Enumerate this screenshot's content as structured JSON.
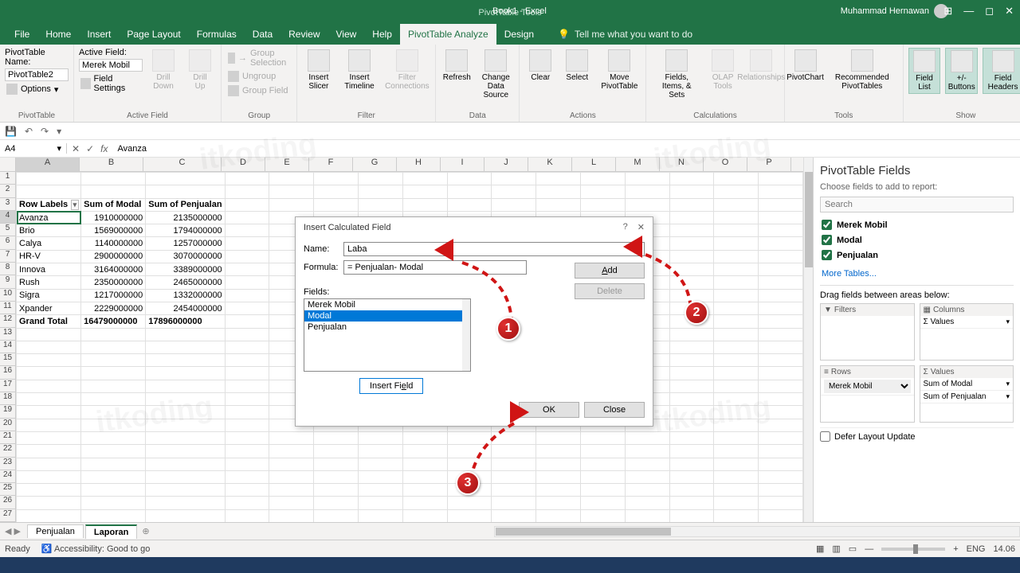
{
  "title": {
    "tools": "PivotTable Tools",
    "doc": "Book1  -  Excel"
  },
  "user": "Muhammad Hernawan",
  "tabs": [
    "File",
    "Home",
    "Insert",
    "Page Layout",
    "Formulas",
    "Data",
    "Review",
    "View",
    "Help",
    "PivotTable Analyze",
    "Design"
  ],
  "active_tab": "PivotTable Analyze",
  "tellme": "Tell me what you want to do",
  "ribbon": {
    "pt_name_label": "PivotTable Name:",
    "pt_name": "PivotTable2",
    "options": "Options",
    "g_pt": "PivotTable",
    "af_label": "Active Field:",
    "af_name": "Merek Mobil",
    "field_settings": "Field Settings",
    "drill_down": "Drill\nDown",
    "drill_up": "Drill\nUp",
    "g_af": "Active Field",
    "group_sel": "Group Selection",
    "ungroup": "Ungroup",
    "group_field": "Group Field",
    "g_group": "Group",
    "ins_slicer": "Insert\nSlicer",
    "ins_timeline": "Insert\nTimeline",
    "filter_conn": "Filter\nConnections",
    "g_filter": "Filter",
    "refresh": "Refresh",
    "change_ds": "Change Data\nSource",
    "g_data": "Data",
    "clear": "Clear",
    "select": "Select",
    "move_pt": "Move\nPivotTable",
    "g_actions": "Actions",
    "fis": "Fields, Items,\n& Sets",
    "olap": "OLAP\nTools",
    "rel": "Relationships",
    "g_calc": "Calculations",
    "pivotchart": "PivotChart",
    "rec_pt": "Recommended\nPivotTables",
    "g_tools": "Tools",
    "fl": "Field\nList",
    "pmb": "+/-\nButtons",
    "fh": "Field\nHeaders",
    "g_show": "Show"
  },
  "namebox": "A4",
  "formula": "Avanza",
  "cols": [
    "A",
    "B",
    "C",
    "D",
    "E",
    "F",
    "G",
    "H",
    "I",
    "J",
    "K",
    "L",
    "M",
    "N",
    "O",
    "P"
  ],
  "pivot": {
    "headers": [
      "Row Labels",
      "Sum of Modal",
      "Sum of Penjualan"
    ],
    "rows": [
      [
        "Avanza",
        "1910000000",
        "2135000000"
      ],
      [
        "Brio",
        "1569000000",
        "1794000000"
      ],
      [
        "Calya",
        "1140000000",
        "1257000000"
      ],
      [
        "HR-V",
        "2900000000",
        "3070000000"
      ],
      [
        "Innova",
        "3164000000",
        "3389000000"
      ],
      [
        "Rush",
        "2350000000",
        "2465000000"
      ],
      [
        "Sigra",
        "1217000000",
        "1332000000"
      ],
      [
        "Xpander",
        "2229000000",
        "2454000000"
      ]
    ],
    "total": [
      "Grand Total",
      "16479000000",
      "17896000000"
    ]
  },
  "dialog": {
    "title": "Insert Calculated Field",
    "name_lbl": "Name:",
    "name": "Laba",
    "formula_lbl": "Formula:",
    "formula": "= Penjualan- Modal",
    "add": "Add",
    "delete": "Delete",
    "fields_lbl": "Fields:",
    "fields": [
      "Merek Mobil",
      "Modal",
      "Penjualan"
    ],
    "selected": 1,
    "insert_field": "Insert Field",
    "ok": "OK",
    "close": "Close"
  },
  "pane": {
    "title": "PivotTable Fields",
    "sub": "Choose fields to add to report:",
    "search": "Search",
    "fields": [
      "Merek Mobil",
      "Modal",
      "Penjualan"
    ],
    "more": "More Tables...",
    "drag": "Drag fields between areas below:",
    "filters": "Filters",
    "columns": "Columns",
    "rows": "Rows",
    "values": "Values",
    "col_item": "Σ Values",
    "row_item": "Merek Mobil",
    "val_items": [
      "Sum of Modal",
      "Sum of Penjualan"
    ],
    "defer": "Defer Layout Update"
  },
  "sheets": [
    "Penjualan",
    "Laporan"
  ],
  "active_sheet": 1,
  "status": {
    "ready": "Ready",
    "acc": "Accessibility: Good to go",
    "lang": "ENG",
    "time": "14.06"
  },
  "ann": {
    "n1": "1",
    "n2": "2",
    "n3": "3"
  }
}
